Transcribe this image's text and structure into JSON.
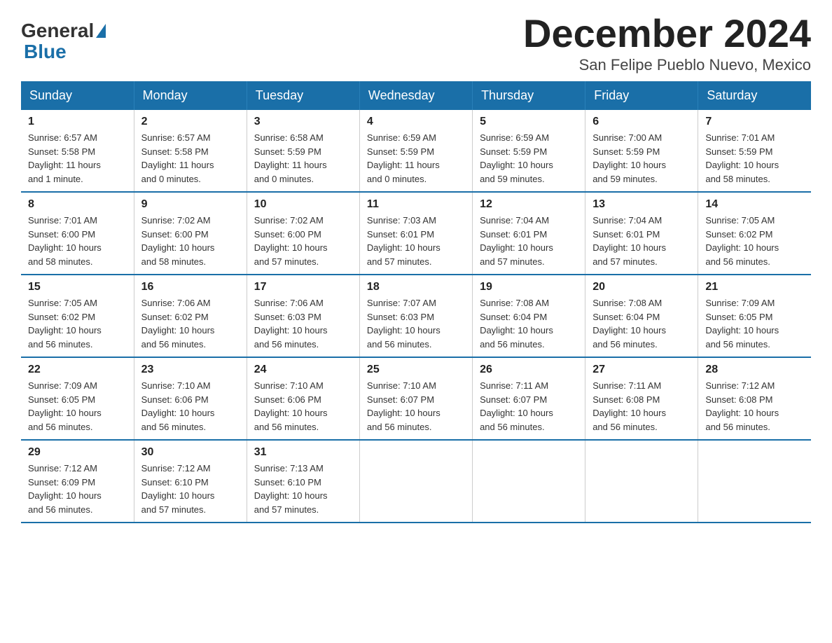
{
  "header": {
    "logo_general": "General",
    "logo_blue": "Blue",
    "title": "December 2024",
    "location": "San Felipe Pueblo Nuevo, Mexico"
  },
  "days_of_week": [
    "Sunday",
    "Monday",
    "Tuesday",
    "Wednesday",
    "Thursday",
    "Friday",
    "Saturday"
  ],
  "weeks": [
    [
      {
        "day": "1",
        "sunrise": "6:57 AM",
        "sunset": "5:58 PM",
        "daylight": "11 hours and 1 minute."
      },
      {
        "day": "2",
        "sunrise": "6:57 AM",
        "sunset": "5:58 PM",
        "daylight": "11 hours and 0 minutes."
      },
      {
        "day": "3",
        "sunrise": "6:58 AM",
        "sunset": "5:59 PM",
        "daylight": "11 hours and 0 minutes."
      },
      {
        "day": "4",
        "sunrise": "6:59 AM",
        "sunset": "5:59 PM",
        "daylight": "11 hours and 0 minutes."
      },
      {
        "day": "5",
        "sunrise": "6:59 AM",
        "sunset": "5:59 PM",
        "daylight": "10 hours and 59 minutes."
      },
      {
        "day": "6",
        "sunrise": "7:00 AM",
        "sunset": "5:59 PM",
        "daylight": "10 hours and 59 minutes."
      },
      {
        "day": "7",
        "sunrise": "7:01 AM",
        "sunset": "5:59 PM",
        "daylight": "10 hours and 58 minutes."
      }
    ],
    [
      {
        "day": "8",
        "sunrise": "7:01 AM",
        "sunset": "6:00 PM",
        "daylight": "10 hours and 58 minutes."
      },
      {
        "day": "9",
        "sunrise": "7:02 AM",
        "sunset": "6:00 PM",
        "daylight": "10 hours and 58 minutes."
      },
      {
        "day": "10",
        "sunrise": "7:02 AM",
        "sunset": "6:00 PM",
        "daylight": "10 hours and 57 minutes."
      },
      {
        "day": "11",
        "sunrise": "7:03 AM",
        "sunset": "6:01 PM",
        "daylight": "10 hours and 57 minutes."
      },
      {
        "day": "12",
        "sunrise": "7:04 AM",
        "sunset": "6:01 PM",
        "daylight": "10 hours and 57 minutes."
      },
      {
        "day": "13",
        "sunrise": "7:04 AM",
        "sunset": "6:01 PM",
        "daylight": "10 hours and 57 minutes."
      },
      {
        "day": "14",
        "sunrise": "7:05 AM",
        "sunset": "6:02 PM",
        "daylight": "10 hours and 56 minutes."
      }
    ],
    [
      {
        "day": "15",
        "sunrise": "7:05 AM",
        "sunset": "6:02 PM",
        "daylight": "10 hours and 56 minutes."
      },
      {
        "day": "16",
        "sunrise": "7:06 AM",
        "sunset": "6:02 PM",
        "daylight": "10 hours and 56 minutes."
      },
      {
        "day": "17",
        "sunrise": "7:06 AM",
        "sunset": "6:03 PM",
        "daylight": "10 hours and 56 minutes."
      },
      {
        "day": "18",
        "sunrise": "7:07 AM",
        "sunset": "6:03 PM",
        "daylight": "10 hours and 56 minutes."
      },
      {
        "day": "19",
        "sunrise": "7:08 AM",
        "sunset": "6:04 PM",
        "daylight": "10 hours and 56 minutes."
      },
      {
        "day": "20",
        "sunrise": "7:08 AM",
        "sunset": "6:04 PM",
        "daylight": "10 hours and 56 minutes."
      },
      {
        "day": "21",
        "sunrise": "7:09 AM",
        "sunset": "6:05 PM",
        "daylight": "10 hours and 56 minutes."
      }
    ],
    [
      {
        "day": "22",
        "sunrise": "7:09 AM",
        "sunset": "6:05 PM",
        "daylight": "10 hours and 56 minutes."
      },
      {
        "day": "23",
        "sunrise": "7:10 AM",
        "sunset": "6:06 PM",
        "daylight": "10 hours and 56 minutes."
      },
      {
        "day": "24",
        "sunrise": "7:10 AM",
        "sunset": "6:06 PM",
        "daylight": "10 hours and 56 minutes."
      },
      {
        "day": "25",
        "sunrise": "7:10 AM",
        "sunset": "6:07 PM",
        "daylight": "10 hours and 56 minutes."
      },
      {
        "day": "26",
        "sunrise": "7:11 AM",
        "sunset": "6:07 PM",
        "daylight": "10 hours and 56 minutes."
      },
      {
        "day": "27",
        "sunrise": "7:11 AM",
        "sunset": "6:08 PM",
        "daylight": "10 hours and 56 minutes."
      },
      {
        "day": "28",
        "sunrise": "7:12 AM",
        "sunset": "6:08 PM",
        "daylight": "10 hours and 56 minutes."
      }
    ],
    [
      {
        "day": "29",
        "sunrise": "7:12 AM",
        "sunset": "6:09 PM",
        "daylight": "10 hours and 56 minutes."
      },
      {
        "day": "30",
        "sunrise": "7:12 AM",
        "sunset": "6:10 PM",
        "daylight": "10 hours and 57 minutes."
      },
      {
        "day": "31",
        "sunrise": "7:13 AM",
        "sunset": "6:10 PM",
        "daylight": "10 hours and 57 minutes."
      },
      null,
      null,
      null,
      null
    ]
  ],
  "labels": {
    "sunrise": "Sunrise:",
    "sunset": "Sunset:",
    "daylight": "Daylight:"
  }
}
